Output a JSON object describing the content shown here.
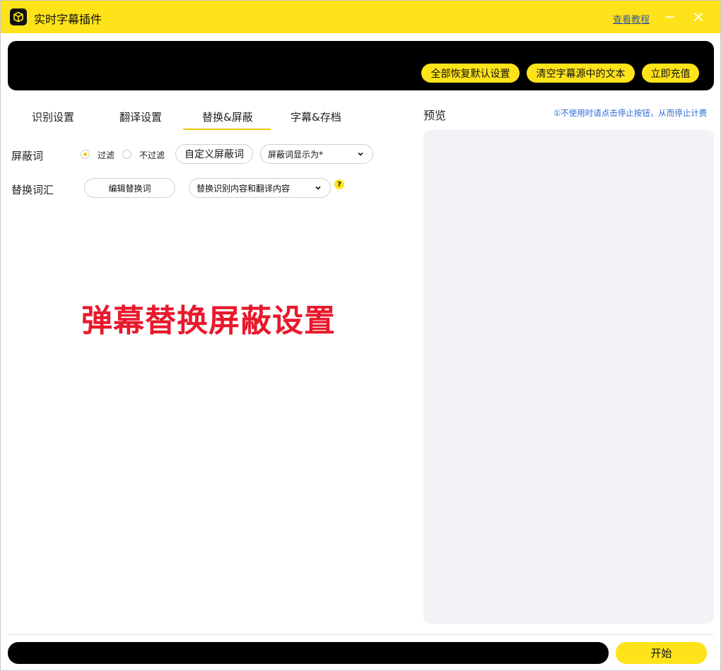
{
  "titlebar": {
    "title": "实时字幕插件",
    "help_link": "查看教程",
    "icons": {
      "app": "box-icon",
      "minimize": "minimize-icon",
      "close": "close-icon"
    }
  },
  "banner": {
    "buttons": [
      "全部恢复默认设置",
      "清空字幕源中的文本",
      "立即充值"
    ]
  },
  "tabs": [
    {
      "label": "识别设置",
      "active": false
    },
    {
      "label": "翻译设置",
      "active": false
    },
    {
      "label": "替换&屏蔽",
      "active": true
    },
    {
      "label": "字幕&存档",
      "active": false
    }
  ],
  "block_words": {
    "label": "屏蔽词",
    "options": [
      {
        "label": "过滤",
        "selected": true
      },
      {
        "label": "不过滤",
        "selected": false
      }
    ],
    "custom_button": "自定义屏蔽词",
    "display_select": "屏蔽词显示为*"
  },
  "replace_words": {
    "label": "替换词汇",
    "edit_button": "编辑替换词",
    "scope_select": "替换识别内容和翻译内容",
    "help_badge": "?"
  },
  "overlay_caption": "弹幕替换屏蔽设置",
  "preview": {
    "title": "预览",
    "tip": "①不使用时请点击停止按钮，从而停止计费"
  },
  "footer": {
    "start_button": "开始"
  },
  "colors": {
    "accent": "#ffe31a",
    "tab_underline": "#f0c800",
    "link": "#2d6bd6",
    "caption": "#e8192c",
    "preview_bg": "#f2f3f7"
  }
}
